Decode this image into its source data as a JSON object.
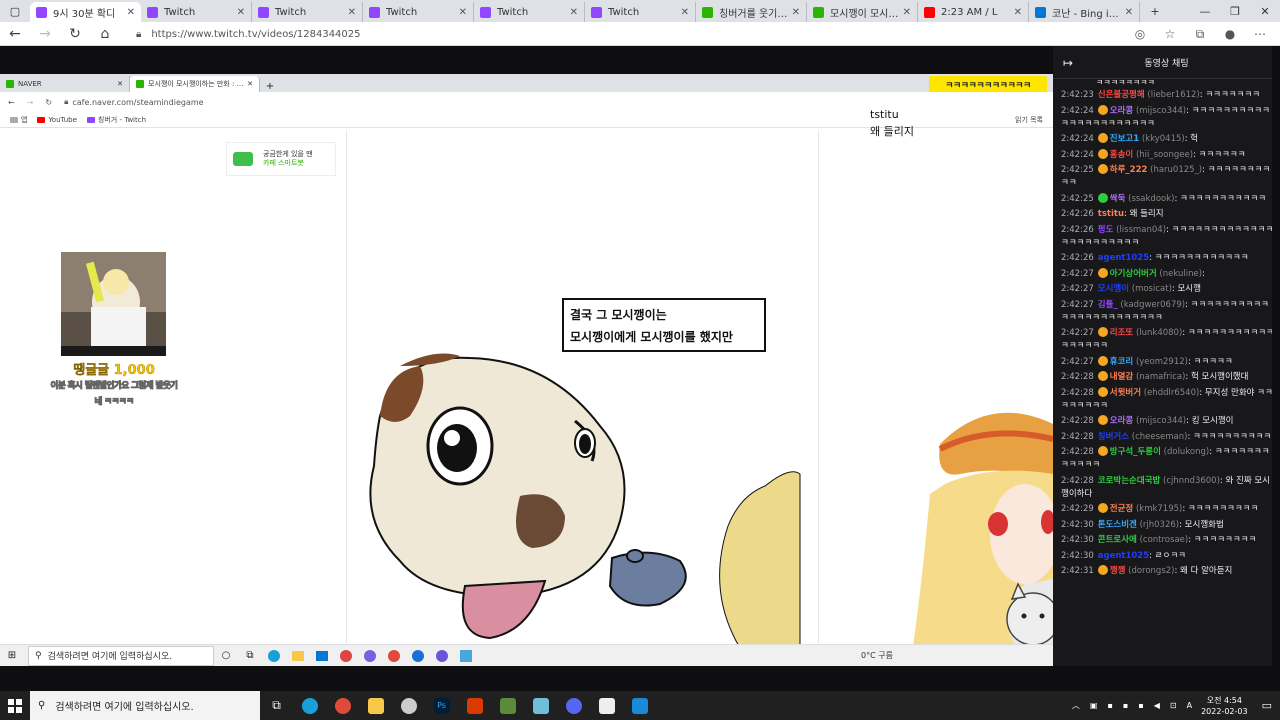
{
  "browser": {
    "tabs": [
      {
        "title": "9시 30분 확디",
        "color": "#9146ff",
        "active": true
      },
      {
        "title": "Twitch",
        "color": "#9146ff"
      },
      {
        "title": "Twitch",
        "color": "#9146ff"
      },
      {
        "title": "Twitch",
        "color": "#9146ff"
      },
      {
        "title": "Twitch",
        "color": "#9146ff"
      },
      {
        "title": "Twitch",
        "color": "#9146ff"
      },
      {
        "title": "칭버거를 웃기는 방",
        "color": "#2db400"
      },
      {
        "title": "모시깽이 모시깽이",
        "color": "#2db400"
      },
      {
        "title": "2:23 AM / L",
        "color": "#ff0000"
      },
      {
        "title": "코난 - Bing images",
        "color": "#0078d4"
      }
    ],
    "url": "https://www.twitch.tv/videos/1284344025"
  },
  "inner_browser": {
    "tabs": [
      {
        "title": "NAVER"
      },
      {
        "title": "모시깽이 모시깽이하는 만화 : 네이"
      }
    ],
    "url": "cafe.naver.com/steamindiegame",
    "bookmarks": [
      {
        "label": "앱"
      },
      {
        "label": "YouTube"
      },
      {
        "label": "칭버거 - Twitch"
      }
    ],
    "reading_list": "읽기 목록",
    "ad_text": "궁금한게 있을 땐",
    "ad_sub": "카페 스마트봇",
    "taskbar_search": "검색하려면 여기에 입력하십시오.",
    "weather": "0°C 구름"
  },
  "stream_overlay": {
    "yellow_badge": "ㅋㅋㅋㅋㅋㅋㅋㅋㅋㅋㅋ",
    "chat_overlay_name": "tstitu",
    "chat_overlay_msg": "왜 들리지",
    "donation_amount": "땡글글 1,000",
    "donation_line1": "이분 혹시 릴렌발인가요 그럼제 발웃기",
    "donation_line2": "네 ㅋㅋㅋㅋ",
    "speech_line1": "결국 그 모시깽이는",
    "speech_line2": "모시깽이에게 모시깽이를 했지만"
  },
  "chat": {
    "title": "동영상 채팅",
    "top_partial": "ㅋㅋㅋㅋㅋㅋㅋㅋ",
    "messages": [
      {
        "ts": "2:42:23",
        "nick": "신은불공평해",
        "id": "(lieber1612)",
        "text": ": ㅋㅋㅋㅋㅋㅋㅋ",
        "color": "#ff4545",
        "badge": ""
      },
      {
        "ts": "2:42:24",
        "nick": "오라콩",
        "id": "(mijsco344)",
        "text": ": ㅋㅋㅋㅋㅋㅋㅋㅋㅋㅋㅋㅋㅋㅋㅋㅋㅋㅋㅋㅋㅋㅋ",
        "color": "#b070ff",
        "badge": "#f5a623"
      },
      {
        "ts": "2:42:24",
        "nick": "진보고1",
        "id": "(kky0415)",
        "text": ": 헉",
        "color": "#33aaff",
        "badge": "#f5a623"
      },
      {
        "ts": "2:42:24",
        "nick": "홍송이",
        "id": "(hii_soongee)",
        "text": ": ㅋㅋㅋㅋㅋㅋ",
        "color": "#ff4545",
        "badge": "#f5a623"
      },
      {
        "ts": "2:42:25",
        "nick": "하루_222",
        "id": "(haru0125_)",
        "text": ": ㅋㅋㅋㅋㅋㅋㅋㅋㅋㅋ",
        "color": "#ff7f50",
        "badge": "#f5a623"
      },
      {
        "ts": "2:42:25",
        "nick": "싹둑",
        "id": "(ssakdook)",
        "text": ": ㅋㅋㅋㅋㅋㅋㅋㅋㅋㅋㅋ",
        "color": "#b070ff",
        "badge": "#2ecc40"
      },
      {
        "ts": "2:42:26",
        "nick": "tstitu",
        "id": "",
        "text": ": 왜 들리지",
        "color": "#ff7f50",
        "badge": ""
      },
      {
        "ts": "2:42:26",
        "nick": "펑도",
        "id": "(lissman04)",
        "text": ": ㅋㅋㅋㅋㅋㅋㅋㅋㅋㅋㅋㅋㅋㅋㅋㅋㅋㅋㅋㅋㅋㅋㅋ",
        "color": "#9146ff",
        "badge": ""
      },
      {
        "ts": "2:42:26",
        "nick": "agent1025",
        "id": "",
        "text": ": ㅋㅋㅋㅋㅋㅋㅋㅋㅋㅋㅋㅋ",
        "color": "#1e3fff",
        "badge": ""
      },
      {
        "ts": "2:42:27",
        "nick": "아기상어버거",
        "id": "(nekuline)",
        "text": ": ",
        "color": "#2ecc40",
        "badge": "#f5a623"
      },
      {
        "ts": "2:42:27",
        "nick": "모시깽이",
        "id": "(mosicat)",
        "text": ": 모시깽",
        "color": "#1e3fff",
        "badge": ""
      },
      {
        "ts": "2:42:27",
        "nick": "김툴_",
        "id": "(kadgwer0679)",
        "text": ": ㅋㅋㅋㅋㅋㅋㅋㅋㅋㅋㅋㅋㅋㅋㅋㅋㅋㅋㅋㅋㅋㅋㅋ",
        "color": "#9146ff",
        "badge": ""
      },
      {
        "ts": "2:42:27",
        "nick": "리조또",
        "id": "(lunk4080)",
        "text": ": ㅋㅋㅋㅋㅋㅋㅋㅋㅋㅋㅋㅋㅋㅋㅋㅋㅋ",
        "color": "#ff4545",
        "badge": "#f5a623"
      },
      {
        "ts": "2:42:27",
        "nick": "휴코리",
        "id": "(yeom2912)",
        "text": ": ㅋㅋㅋㅋㅋ",
        "color": "#33aaff",
        "badge": "#f5a623"
      },
      {
        "ts": "2:42:28",
        "nick": "내열감",
        "id": "(namafrica)",
        "text": ": 헉 모시깽이했대",
        "color": "#ff7f50",
        "badge": "#f5a623"
      },
      {
        "ts": "2:42:28",
        "nick": "서윗버거",
        "id": "(ehddlr6540)",
        "text": ": 무지성 만화야 ㅋㅋㅋㅋㅋㅋㅋㅋ",
        "color": "#ff7f50",
        "badge": "#f5a623"
      },
      {
        "ts": "2:42:28",
        "nick": "오라콩",
        "id": "(mijsco344)",
        "text": ": 킹 모시깽이",
        "color": "#b070ff",
        "badge": "#f5a623"
      },
      {
        "ts": "2:42:28",
        "nick": "칭버거스",
        "id": "(cheeseman)",
        "text": ": ㅋㅋㅋㅋㅋㅋㅋㅋㅋㅋ",
        "color": "#1e3fff",
        "badge": ""
      },
      {
        "ts": "2:42:28",
        "nick": "방구석_두롱이",
        "id": "(dolukong)",
        "text": ": ㅋㅋㅋㅋㅋㅋㅋㅋㅋㅋㅋㅋ",
        "color": "#2ecc40",
        "badge": "#f5a623"
      },
      {
        "ts": "2:42:28",
        "nick": "코로박는순대국밥",
        "id": "(cjhnnd3600)",
        "text": ": 와 진짜 모시깽이하다",
        "color": "#2ecc40",
        "badge": ""
      },
      {
        "ts": "2:42:29",
        "nick": "전균정",
        "id": "(kmk7195)",
        "text": ": ㅋㅋㅋㅋㅋㅋㅋㅋㅋ",
        "color": "#ff7f50",
        "badge": "#f5a623"
      },
      {
        "ts": "2:42:30",
        "nick": "톤도스비겐",
        "id": "(rjh0326)",
        "text": ": 모시깽화법",
        "color": "#33aaff",
        "badge": ""
      },
      {
        "ts": "2:42:30",
        "nick": "콘트로사에",
        "id": "(controsae)",
        "text": ": ㅋㅋㅋㅋㅋㅋㅋㅋ",
        "color": "#2ecc40",
        "badge": ""
      },
      {
        "ts": "2:42:30",
        "nick": "agent1025",
        "id": "",
        "text": ": ㄹㅇㅋㅋ",
        "color": "#1e3fff",
        "badge": ""
      },
      {
        "ts": "2:42:31",
        "nick": "깽껭",
        "id": "(dorongs2)",
        "text": ": 왜 다 알아듣지",
        "color": "#ff4545",
        "badge": "#f5a623"
      }
    ]
  },
  "taskbar": {
    "search_placeholder": "검색하려면 여기에 입력하십시오.",
    "time": "오전 4:54",
    "date": "2022-02-03"
  }
}
